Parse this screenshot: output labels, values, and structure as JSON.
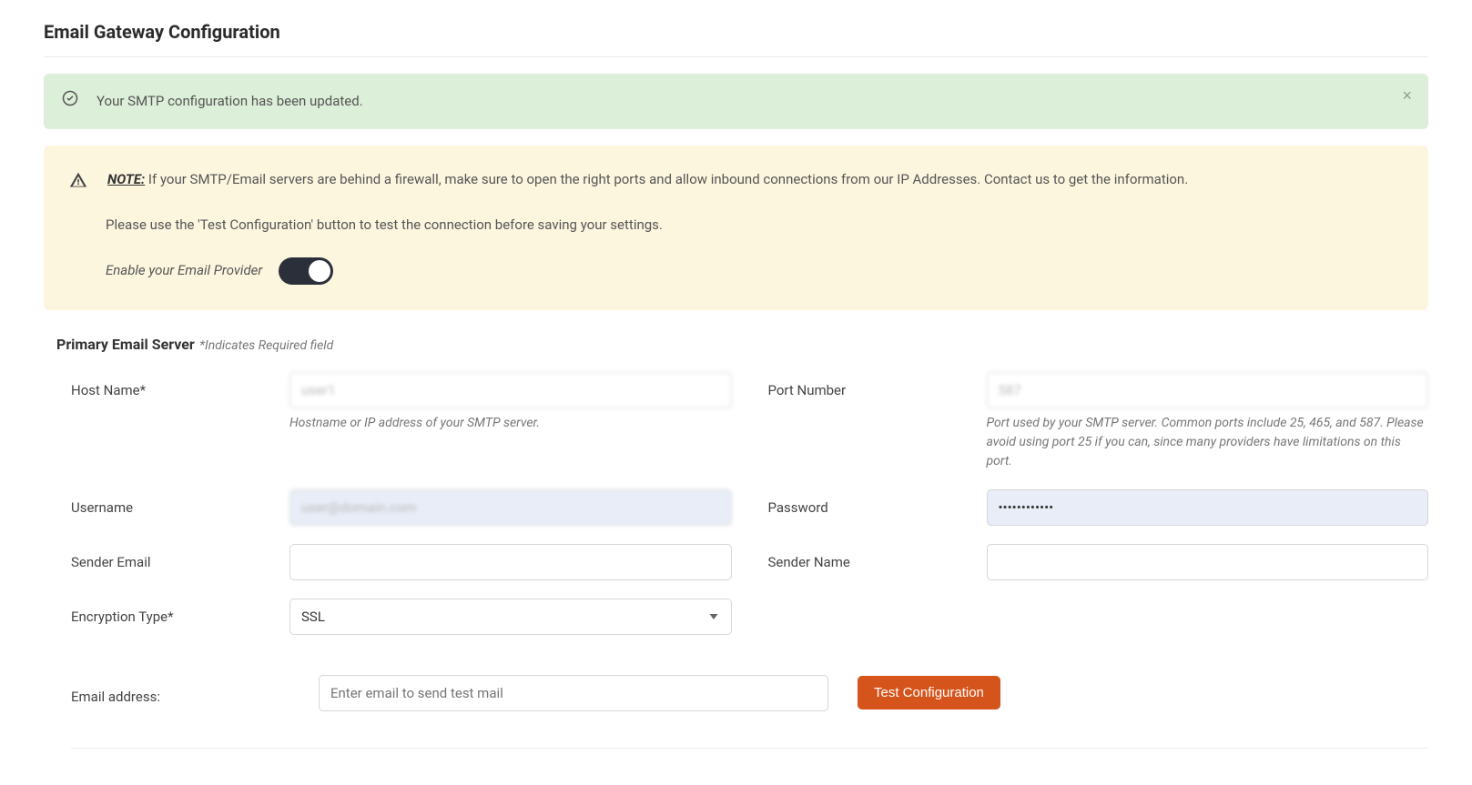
{
  "page": {
    "title": "Email Gateway Configuration"
  },
  "alerts": {
    "success": {
      "message": "Your SMTP configuration has been updated.",
      "close": "×"
    },
    "warning": {
      "note_label": "NOTE:",
      "note_text": " If your SMTP/Email servers are behind a firewall, make sure to open the right ports and allow inbound connections from our IP Addresses. Contact us to get the information.",
      "line2": "Please use the 'Test Configuration' button to test the connection before saving your settings.",
      "enable_label": "Enable your Email Provider"
    }
  },
  "section": {
    "title": "Primary Email Server",
    "hint": " *Indicates Required field"
  },
  "form": {
    "host": {
      "label": "Host Name*",
      "value": "user1",
      "help": "Hostname or IP address of your SMTP server."
    },
    "port": {
      "label": "Port Number",
      "value": "587",
      "help": "Port used by your SMTP server. Common ports include 25, 465, and 587. Please avoid using port 25 if you can, since many providers have limitations on this port."
    },
    "username": {
      "label": "Username",
      "value": "user@domain.com"
    },
    "password": {
      "label": "Password",
      "value": "••••••••••••"
    },
    "sender_email": {
      "label": "Sender Email",
      "value": ""
    },
    "sender_name": {
      "label": "Sender Name",
      "value": ""
    },
    "encryption": {
      "label": "Encryption Type*",
      "value": "SSL"
    },
    "test": {
      "label": "Email address:",
      "placeholder": "Enter email to send test mail",
      "button": "Test Configuration"
    }
  }
}
